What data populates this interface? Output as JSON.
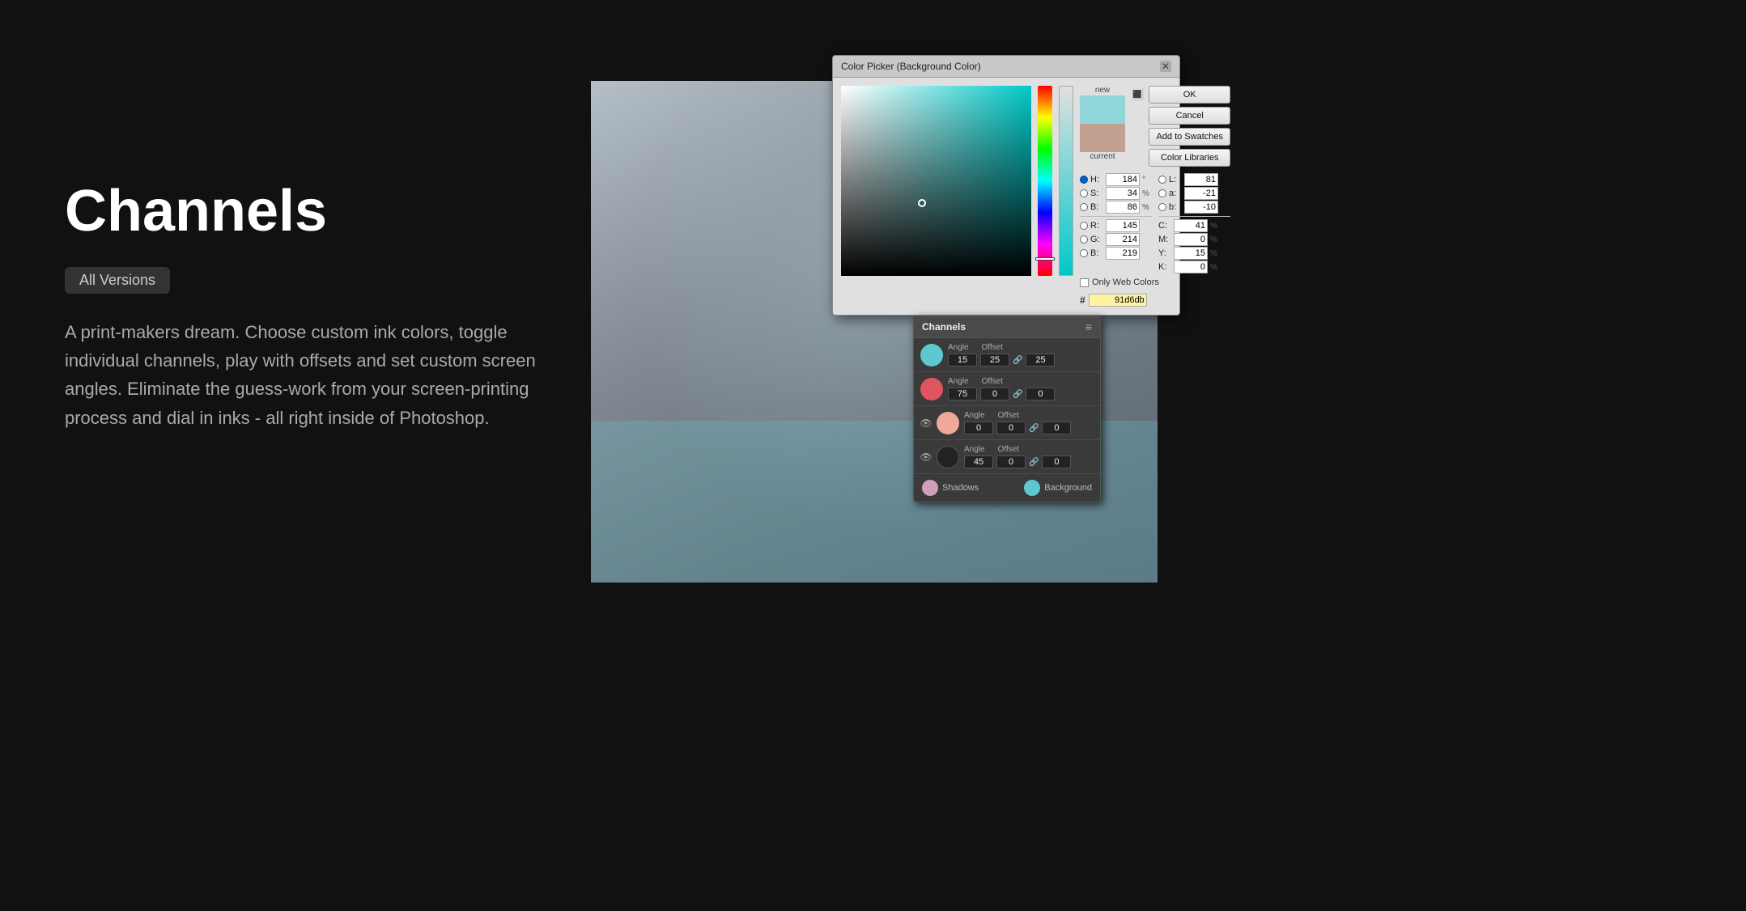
{
  "page": {
    "title": "Channels",
    "version_badge": "All Versions",
    "description": "A print-makers dream. Choose custom ink colors, toggle individual channels, play with offsets and set custom screen angles. Eliminate the guess-work from your screen-printing process and dial in inks - all right inside of Photoshop."
  },
  "color_picker": {
    "title": "Color Picker (Background Color)",
    "close_label": "✕",
    "buttons": {
      "ok": "OK",
      "cancel": "Cancel",
      "add_to_swatches": "Add to Swatches",
      "color_libraries": "Color Libraries"
    },
    "swatch": {
      "new_label": "new",
      "current_label": "current",
      "new_color": "#91d6db",
      "current_color": "#c4a090"
    },
    "fields": {
      "h_label": "H:",
      "h_value": "184",
      "h_unit": "°",
      "s_label": "S:",
      "s_value": "34",
      "s_unit": "%",
      "b_label": "B:",
      "b_value": "86",
      "b_unit": "%",
      "r_label": "R:",
      "r_value": "145",
      "g_label": "G:",
      "g_value": "214",
      "b2_label": "B:",
      "b2_value": "219",
      "l_label": "L:",
      "l_value": "81",
      "a_label": "a:",
      "a_value": "-21",
      "b3_label": "b:",
      "b3_value": "-10",
      "c_label": "C:",
      "c_value": "41",
      "c_unit": "%",
      "m_label": "M:",
      "m_value": "0",
      "m_unit": "%",
      "y_label": "Y:",
      "y_value": "15",
      "y_unit": "%",
      "k_label": "K:",
      "k_value": "0",
      "k_unit": "%"
    },
    "hex_label": "#",
    "hex_value": "91d6db",
    "only_web_colors": "Only Web Colors"
  },
  "channels_panel": {
    "title": "Channels",
    "channels": [
      {
        "color": "#5cc8d0",
        "angle_label": "Angle",
        "angle_value": "15",
        "offset_label": "Offset",
        "offset_value1": "25",
        "offset_value2": "25",
        "visible": true
      },
      {
        "color": "#e05560",
        "angle_label": "Angle",
        "angle_value": "75",
        "offset_label": "Offset",
        "offset_value1": "0",
        "offset_value2": "0",
        "visible": true
      },
      {
        "color": "#f0a898",
        "angle_label": "Angle",
        "angle_value": "0",
        "offset_label": "Offset",
        "offset_value1": "0",
        "offset_value2": "0",
        "visible": true
      },
      {
        "color": "#111111",
        "angle_label": "Angle",
        "angle_value": "45",
        "offset_label": "Offset",
        "offset_value1": "0",
        "offset_value2": "0",
        "visible": true
      }
    ],
    "footer": {
      "shadows_label": "Shadows",
      "shadows_color": "#d0a0b8",
      "background_label": "Background",
      "background_color": "#5cc8d0"
    }
  }
}
